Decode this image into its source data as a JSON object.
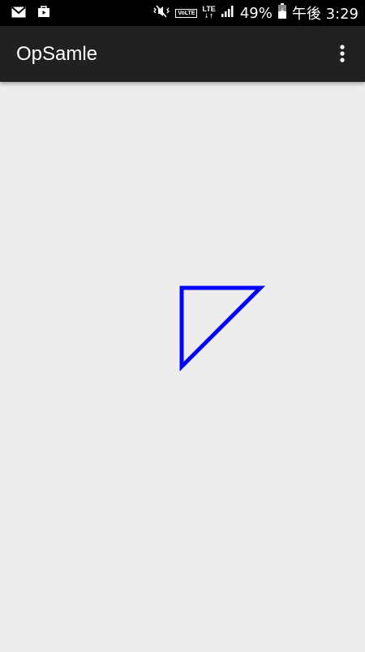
{
  "status_bar": {
    "left_icons": [
      "gmail-icon",
      "store-bag-icon"
    ],
    "right_icons": [
      "vibrate-mute-icon",
      "volte-icon",
      "lte-icon",
      "signal-icon",
      "battery-icon"
    ],
    "volte_label": "VoLTE",
    "network_label": "LTE",
    "battery_percent": "49%",
    "time": "午後 3:29"
  },
  "app_bar": {
    "title": "OpSamle",
    "menu_icon": "more-vert-icon"
  },
  "drawing": {
    "shape": "right-triangle",
    "stroke_color": "#0000ff",
    "background_color": "#ededed"
  }
}
